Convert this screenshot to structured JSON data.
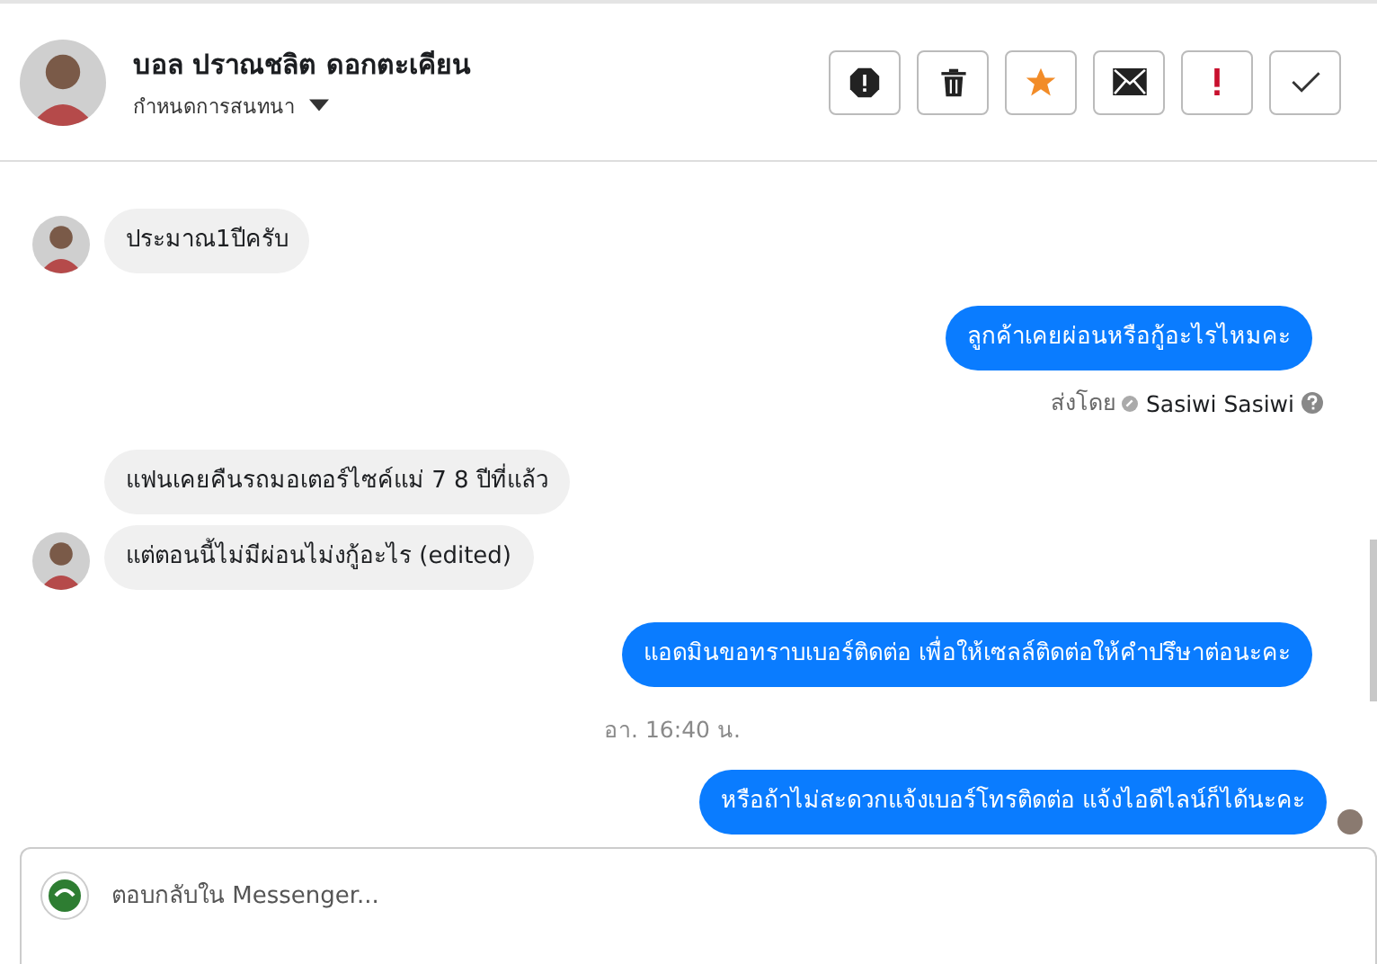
{
  "header": {
    "name": "บอล ปราณชลิต ดอกตะเคียน",
    "subtitle": "กำหนดการสนทนา",
    "actions": [
      {
        "kind": "spam"
      },
      {
        "kind": "delete"
      },
      {
        "kind": "star"
      },
      {
        "kind": "mail"
      },
      {
        "kind": "important"
      },
      {
        "kind": "done"
      }
    ]
  },
  "messages": [
    {
      "kind": "incoming",
      "text": "ประมาณ1ปีครับ",
      "show_avatar": true
    },
    {
      "kind": "outgoing",
      "text": "ลูกค้าเคยผ่อนหรือกู้อะไรไหมคะ",
      "seen": false
    },
    {
      "kind": "sender",
      "prefix": "ส่งโดย",
      "name": "Sasiwi Sasiwi"
    },
    {
      "kind": "incoming",
      "text": "แฟนเคยคืนรถมอเตอร์ไซค์แม่ 7 8 ปีที่แล้ว",
      "show_avatar": false
    },
    {
      "kind": "incoming",
      "text": "แต่ตอนนี้ไม่มีผ่อนไม่งกู้อะไร (edited)",
      "show_avatar": true
    },
    {
      "kind": "outgoing",
      "text": "แอดมินขอทราบเบอร์ติดต่อ เพื่อให้เซลล์ติดต่อให้คำปรึษาต่อนะคะ",
      "seen": false
    },
    {
      "kind": "time",
      "text": "อา. 16:40 น."
    },
    {
      "kind": "outgoing",
      "text": "หรือถ้าไม่สะดวกแจ้งเบอร์โทรติดต่อ แจ้งไอดีไลน์ก็ได้นะคะ",
      "seen": true
    }
  ],
  "composer": {
    "placeholder": "ตอบกลับใน Messenger..."
  }
}
